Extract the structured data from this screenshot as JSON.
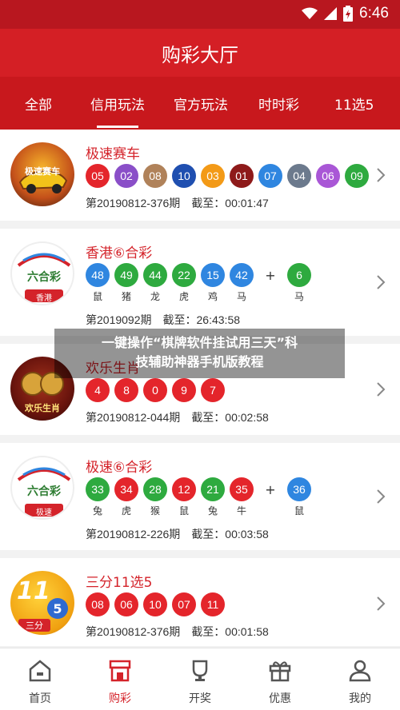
{
  "status": {
    "time": "6:46"
  },
  "header": {
    "title": "购彩大厅"
  },
  "tabs": [
    {
      "label": "全部"
    },
    {
      "label": "信用玩法"
    },
    {
      "label": "官方玩法"
    },
    {
      "label": "时时彩"
    },
    {
      "label": "11选5"
    }
  ],
  "games": [
    {
      "title": "极速赛车",
      "logo_text": "极速赛车",
      "balls": [
        {
          "n": "05",
          "color": "#e4252b"
        },
        {
          "n": "02",
          "color": "#8a4fc8"
        },
        {
          "n": "08",
          "color": "#b0825a"
        },
        {
          "n": "10",
          "color": "#1f4fb0"
        },
        {
          "n": "03",
          "color": "#f39a17"
        },
        {
          "n": "01",
          "color": "#8e1a1a"
        },
        {
          "n": "07",
          "color": "#2f86e0"
        },
        {
          "n": "04",
          "color": "#6c7a8d"
        },
        {
          "n": "06",
          "color": "#a957d6"
        },
        {
          "n": "09",
          "color": "#2eaa3f"
        }
      ],
      "issue": "第20190812-376期",
      "deadline": "截至：00:01:47"
    },
    {
      "title": "香港⑥合彩",
      "logo_text": "六合彩",
      "logo_sub": "香港",
      "balls": [
        {
          "n": "48",
          "color": "#2f86e0"
        },
        {
          "n": "49",
          "color": "#2eaa3f"
        },
        {
          "n": "44",
          "color": "#2eaa3f"
        },
        {
          "n": "22",
          "color": "#2eaa3f"
        },
        {
          "n": "15",
          "color": "#2f86e0"
        },
        {
          "n": "42",
          "color": "#2f86e0"
        }
      ],
      "special": {
        "n": "6",
        "color": "#2eaa3f"
      },
      "zodiacs": [
        "鼠",
        "猪",
        "龙",
        "虎",
        "鸡",
        "马"
      ],
      "special_zodiac": "马",
      "issue": "第2019092期",
      "deadline": "截至：26:43:58"
    },
    {
      "title": "欢乐生肖",
      "logo_text": "欢乐生肖",
      "balls": [
        {
          "n": "4",
          "color": "#e4252b"
        },
        {
          "n": "8",
          "color": "#e4252b"
        },
        {
          "n": "0",
          "color": "#e4252b"
        },
        {
          "n": "9",
          "color": "#e4252b"
        },
        {
          "n": "7",
          "color": "#e4252b"
        }
      ],
      "issue": "第20190812-044期",
      "deadline": "截至：00:02:58"
    },
    {
      "title": "极速⑥合彩",
      "logo_text": "六合彩",
      "logo_sub": "极速",
      "balls": [
        {
          "n": "33",
          "color": "#2eaa3f"
        },
        {
          "n": "34",
          "color": "#e4252b"
        },
        {
          "n": "28",
          "color": "#2eaa3f"
        },
        {
          "n": "12",
          "color": "#e4252b"
        },
        {
          "n": "21",
          "color": "#2eaa3f"
        },
        {
          "n": "35",
          "color": "#e4252b"
        }
      ],
      "special": {
        "n": "36",
        "color": "#2f86e0"
      },
      "zodiacs": [
        "兔",
        "虎",
        "猴",
        "鼠",
        "兔",
        "牛"
      ],
      "special_zodiac": "鼠",
      "issue": "第20190812-226期",
      "deadline": "截至：00:03:58"
    },
    {
      "title": "三分11选5",
      "logo_text": "11",
      "logo_sub": "三分",
      "logo_badge": "5",
      "balls": [
        {
          "n": "08",
          "color": "#e4252b"
        },
        {
          "n": "06",
          "color": "#e4252b"
        },
        {
          "n": "10",
          "color": "#e4252b"
        },
        {
          "n": "07",
          "color": "#e4252b"
        },
        {
          "n": "11",
          "color": "#e4252b"
        }
      ],
      "issue": "第20190812-376期",
      "deadline": "截至：00:01:58"
    }
  ],
  "overlay": {
    "line1": "一键操作“棋牌软件挂试用三天”科",
    "line2": "技辅助神器手机版教程"
  },
  "nav": [
    {
      "label": "首页",
      "icon": "home-icon"
    },
    {
      "label": "购彩",
      "icon": "shop-icon"
    },
    {
      "label": "开奖",
      "icon": "trophy-icon"
    },
    {
      "label": "优惠",
      "icon": "gift-icon"
    },
    {
      "label": "我的",
      "icon": "user-icon"
    }
  ],
  "colors": {
    "brand_red": "#d41f25",
    "dark_red": "#c8181d",
    "active_text": "#d4232a"
  }
}
